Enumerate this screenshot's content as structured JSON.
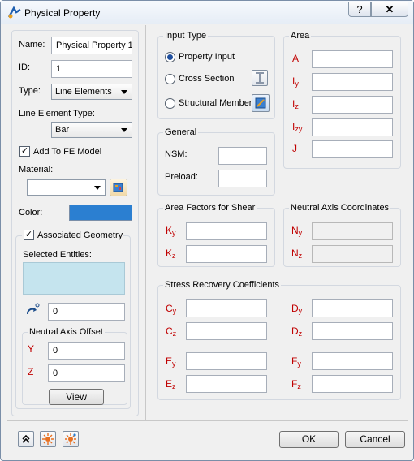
{
  "window": {
    "title": "Physical Property",
    "help_label": "?",
    "close_label": "✕"
  },
  "left": {
    "name_label": "Name:",
    "name_value": "Physical Property 1",
    "id_label": "ID:",
    "id_value": "1",
    "type_label": "Type:",
    "type_value": "Line Elements",
    "line_element_type_label": "Line Element Type:",
    "line_element_type_value": "Bar",
    "add_to_fe_label": "Add To FE Model",
    "add_to_fe_checked": true,
    "material_label": "Material:",
    "material_value": "",
    "color_label": "Color:",
    "color_value": "#2b7fd1",
    "associated_geometry_label": "Associated Geometry",
    "associated_geometry_checked": true,
    "selected_entities_label": "Selected Entities:",
    "angle_value": "0",
    "neutral_axis_offset_label": "Neutral Axis Offset",
    "offset_y_label": "Y",
    "offset_y_value": "0",
    "offset_z_label": "Z",
    "offset_z_value": "0",
    "view_button": "View"
  },
  "input_type": {
    "label": "Input Type",
    "options": [
      "Property Input",
      "Cross Section",
      "Structural Member"
    ],
    "selected": "Property Input"
  },
  "area": {
    "label": "Area",
    "fields": [
      {
        "sym": "A",
        "sub": "",
        "value": ""
      },
      {
        "sym": "I",
        "sub": "y",
        "value": ""
      },
      {
        "sym": "I",
        "sub": "z",
        "value": ""
      },
      {
        "sym": "I",
        "sub": "zy",
        "value": ""
      },
      {
        "sym": "J",
        "sub": "",
        "value": ""
      }
    ]
  },
  "general": {
    "label": "General",
    "nsm_label": "NSM:",
    "nsm_value": "",
    "preload_label": "Preload:",
    "preload_value": ""
  },
  "shear": {
    "label": "Area Factors for Shear",
    "ky_sym": "K",
    "ky_sub": "y",
    "ky_value": "",
    "kz_sym": "K",
    "kz_sub": "z",
    "kz_value": ""
  },
  "neutral_axis": {
    "label": "Neutral Axis Coordinates",
    "ny_sym": "N",
    "ny_sub": "y",
    "ny_value": "",
    "nz_sym": "N",
    "nz_sub": "z",
    "nz_value": ""
  },
  "stress": {
    "label": "Stress Recovery Coefficients",
    "cy": {
      "sym": "C",
      "sub": "y",
      "value": ""
    },
    "cz": {
      "sym": "C",
      "sub": "z",
      "value": ""
    },
    "dy": {
      "sym": "D",
      "sub": "y",
      "value": ""
    },
    "dz": {
      "sym": "D",
      "sub": "z",
      "value": ""
    },
    "ey": {
      "sym": "E",
      "sub": "y",
      "value": ""
    },
    "ez": {
      "sym": "E",
      "sub": "z",
      "value": ""
    },
    "fy": {
      "sym": "F",
      "sub": "y",
      "value": ""
    },
    "fz": {
      "sym": "F",
      "sub": "z",
      "value": ""
    }
  },
  "footer": {
    "ok_label": "OK",
    "cancel_label": "Cancel"
  },
  "icons": [
    "app-icon",
    "cross-section-icon",
    "structural-member-icon",
    "material-browse-icon",
    "angle-icon",
    "collapse-icon",
    "sun-icon",
    "sun-multi-icon"
  ]
}
